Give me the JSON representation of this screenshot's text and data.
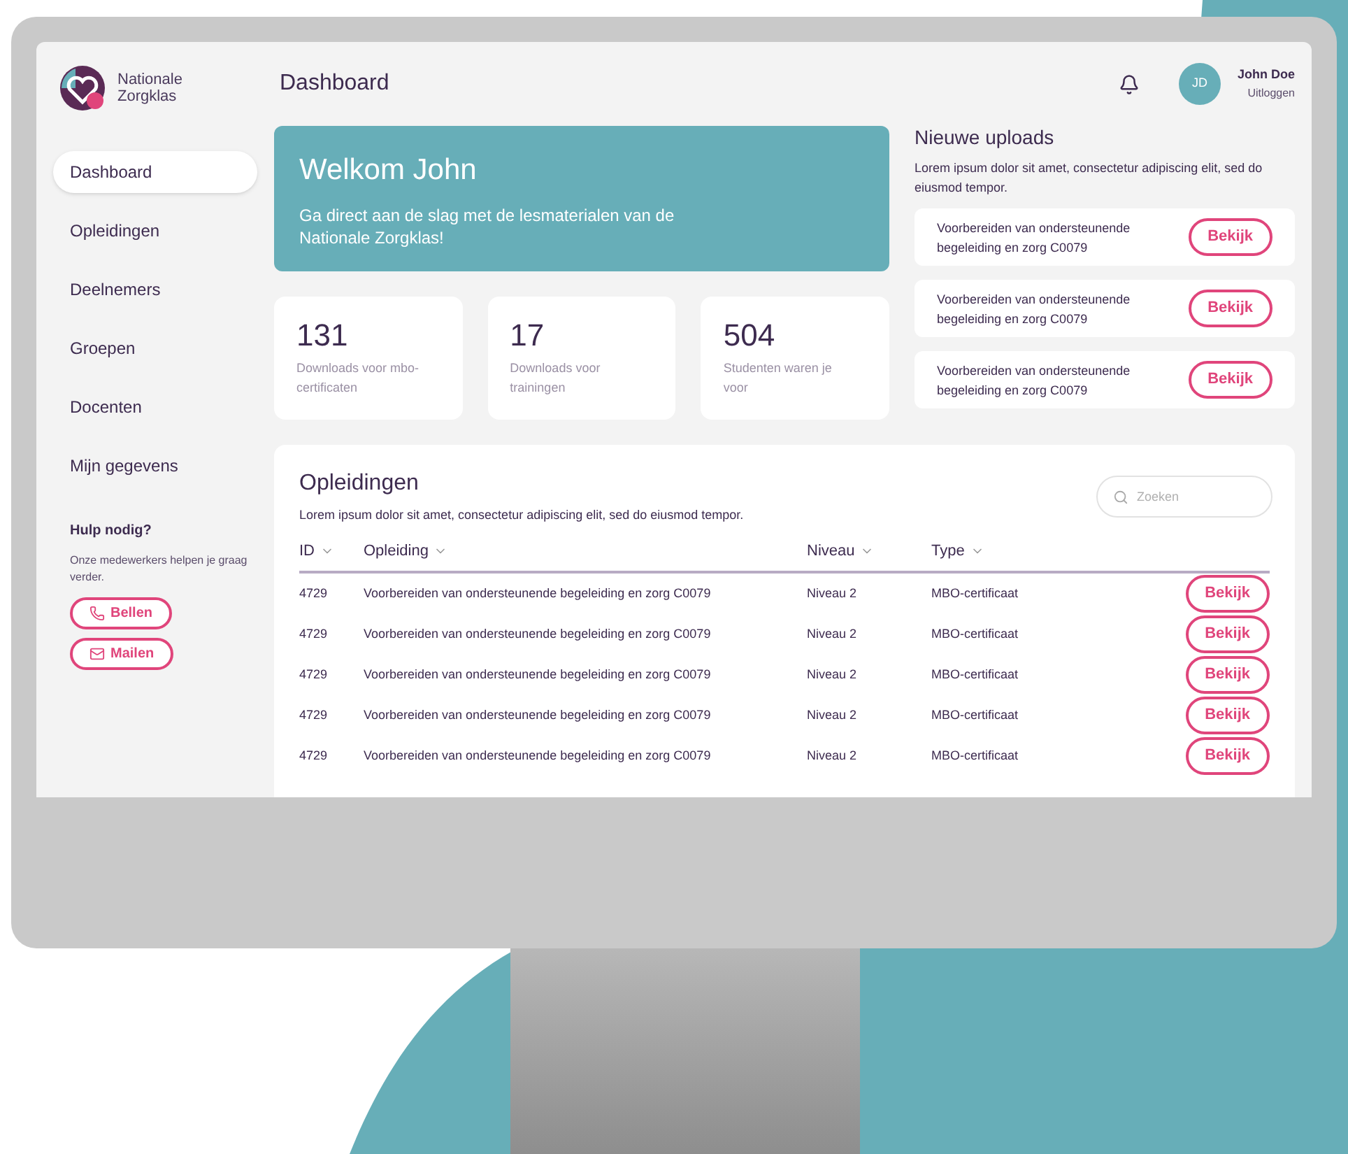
{
  "logo": {
    "line_1": "Nationale",
    "line_2": "Zorgklas"
  },
  "header": {
    "title": "Dashboard",
    "user": {
      "initials": "JD",
      "name": "John Doe",
      "logout": "Uitloggen"
    }
  },
  "sidebar": {
    "items": [
      {
        "label": "Dashboard",
        "selected": true
      },
      {
        "label": "Opleidingen",
        "selected": false
      },
      {
        "label": "Deelnemers",
        "selected": false
      },
      {
        "label": "Groepen",
        "selected": false
      },
      {
        "label": "Docenten",
        "selected": false
      },
      {
        "label": "Mijn gegevens",
        "selected": false
      }
    ],
    "help": {
      "title": "Hulp nodig?",
      "text": "Onze medewerkers helpen je graag verder.",
      "buttons": [
        {
          "label": "Bellen",
          "kind": "phone"
        },
        {
          "label": "Mailen",
          "kind": "mail"
        }
      ]
    }
  },
  "welcome": {
    "title": "Welkom John",
    "text": "Ga direct aan de slag met de lesmaterialen van de Nationale Zorgklas!"
  },
  "stats": [
    {
      "value": "131",
      "label": "Downloads voor mbo-certificaten"
    },
    {
      "value": "17",
      "label": "Downloads voor trainingen"
    },
    {
      "value": "504",
      "label": "Studenten waren je voor"
    }
  ],
  "uploads": {
    "title": "Nieuwe uploads",
    "text": "Lorem ipsum dolor sit amet, consectetur adipiscing elit, sed do eiusmod tempor.",
    "items": [
      {
        "title": "Voorbereiden van ondersteunende begeleiding en zorg C0079",
        "button": "Bekijk"
      },
      {
        "title": "Voorbereiden van ondersteunende begeleiding en zorg C0079",
        "button": "Bekijk"
      },
      {
        "title": "Voorbereiden van ondersteunende begeleiding en zorg C0079",
        "button": "Bekijk"
      }
    ]
  },
  "table": {
    "title": "Opleidingen",
    "description": "Lorem ipsum dolor sit amet, consectetur adipiscing elit, sed do eiusmod tempor.",
    "search": {
      "placeholder": "Zoeken"
    },
    "columns": [
      "ID",
      "Opleiding",
      "Niveau",
      "Type"
    ],
    "rows": [
      {
        "cells": [
          "4729",
          "Voorbereiden van ondersteunende begeleiding en zorg C0079",
          "Niveau 2",
          "MBO-certificaat"
        ],
        "action": "Bekijk"
      },
      {
        "cells": [
          "4729",
          "Voorbereiden van ondersteunende begeleiding en zorg C0079",
          "Niveau 2",
          "MBO-certificaat"
        ],
        "action": "Bekijk"
      },
      {
        "cells": [
          "4729",
          "Voorbereiden van ondersteunende begeleiding en zorg C0079",
          "Niveau 2",
          "MBO-certificaat"
        ],
        "action": "Bekijk"
      },
      {
        "cells": [
          "4729",
          "Voorbereiden van ondersteunende begeleiding en zorg C0079",
          "Niveau 2",
          "MBO-certificaat"
        ],
        "action": "Bekijk"
      },
      {
        "cells": [
          "4729",
          "Voorbereiden van ondersteunende begeleiding en zorg C0079",
          "Niveau 2",
          "MBO-certificaat"
        ],
        "action": "Bekijk"
      }
    ]
  }
}
